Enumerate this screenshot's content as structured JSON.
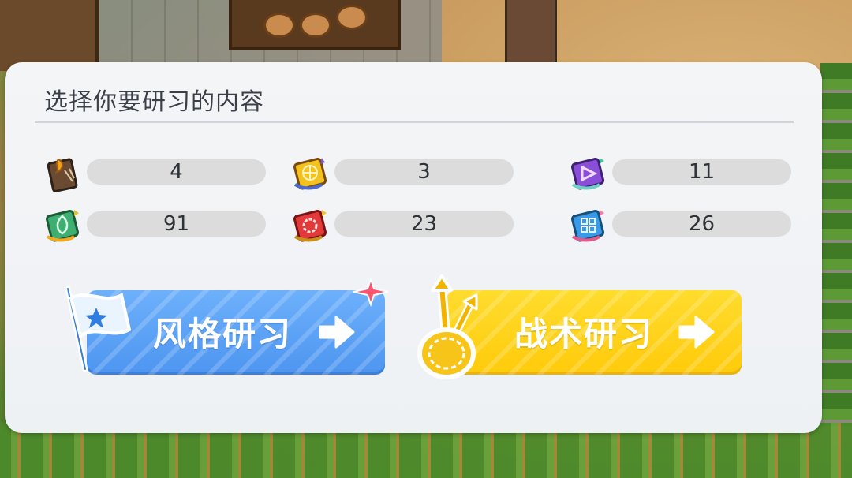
{
  "dialog": {
    "title": "选择你要研习的内容"
  },
  "resources": [
    {
      "icon": "flame-book-icon",
      "value": "4"
    },
    {
      "icon": "gold-book-icon",
      "value": "3"
    },
    {
      "icon": "purple-triangle-book-icon",
      "value": "11"
    },
    {
      "icon": "green-leaf-book-icon",
      "value": "91"
    },
    {
      "icon": "red-gear-book-icon",
      "value": "23"
    },
    {
      "icon": "blue-grid-book-icon",
      "value": "26"
    }
  ],
  "buttons": {
    "style_label": "风格研习",
    "tactic_label": "战术研习"
  },
  "colors": {
    "style_button": "#5aa2f6",
    "tactic_button": "#ffd21a",
    "panel": "#f1f3f6",
    "pill": "#dcdcdc"
  }
}
